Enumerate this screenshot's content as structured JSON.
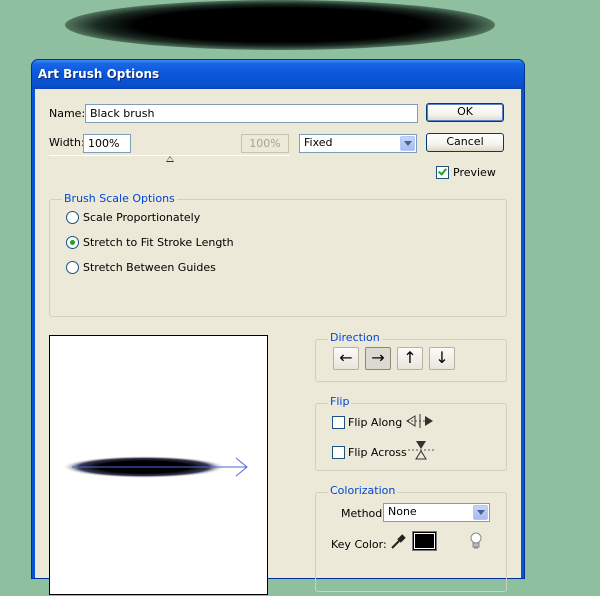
{
  "window": {
    "title": "Art Brush Options"
  },
  "name_field": {
    "label": "Name:",
    "value": "Black brush"
  },
  "width_field": {
    "label": "Width:",
    "value": "100%",
    "disabled_value": "100%",
    "slider_fraction": 0.5
  },
  "width_mode": {
    "selected": "Fixed"
  },
  "buttons": {
    "ok": "OK",
    "cancel": "Cancel"
  },
  "preview": {
    "label": "Preview",
    "checked": true
  },
  "scale_options": {
    "title": "Brush Scale Options",
    "options": [
      {
        "label": "Scale Proportionately",
        "selected": false
      },
      {
        "label": "Stretch to Fit Stroke Length",
        "selected": true
      },
      {
        "label": "Stretch Between Guides",
        "selected": false
      }
    ]
  },
  "direction": {
    "title": "Direction",
    "buttons": [
      {
        "icon": "arrow-left-icon",
        "glyph": "←",
        "active": false
      },
      {
        "icon": "arrow-right-icon",
        "glyph": "→",
        "active": true
      },
      {
        "icon": "arrow-up-icon",
        "glyph": "↑",
        "active": false
      },
      {
        "icon": "arrow-down-icon",
        "glyph": "↓",
        "active": false
      }
    ]
  },
  "flip": {
    "title": "Flip",
    "along": {
      "label": "Flip Along",
      "checked": false,
      "icon": "flip-along-icon"
    },
    "across": {
      "label": "Flip Across",
      "checked": false,
      "icon": "flip-across-icon"
    }
  },
  "colorization": {
    "title": "Colorization",
    "method_label": "Method:",
    "method_value": "None",
    "key_color_label": "Key Color:",
    "key_color": "#000000",
    "eyedropper_icon": "eyedropper-icon",
    "tips_icon": "lightbulb-icon"
  },
  "colors": {
    "canvas": "#8ebf9f",
    "titlebar": "#0a56d9",
    "dialog": "#ece9d8",
    "group_title": "#0046d5",
    "check_green": "#21a121"
  }
}
